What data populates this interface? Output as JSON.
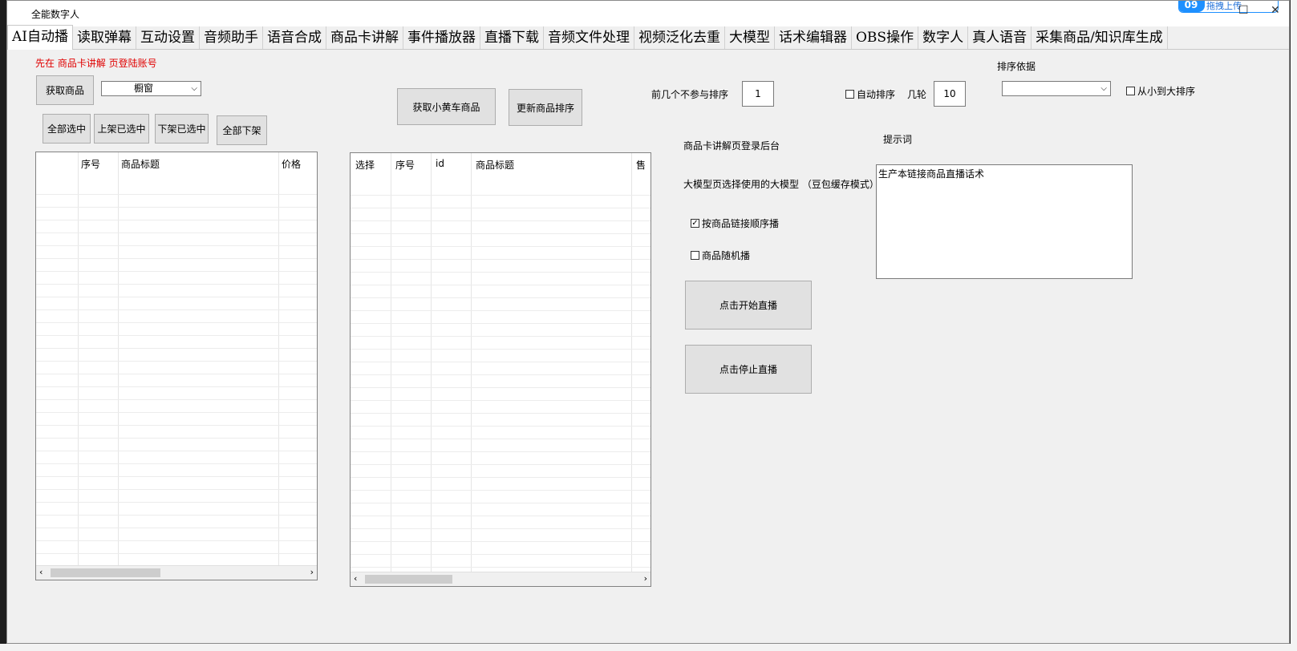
{
  "window": {
    "title": "全能数字人",
    "upload_badge": "09",
    "upload_text": "拖拽上传"
  },
  "tabs": [
    {
      "label": "AI自动播",
      "active": true
    },
    {
      "label": "读取弹幕"
    },
    {
      "label": "互动设置"
    },
    {
      "label": "音频助手"
    },
    {
      "label": "语音合成"
    },
    {
      "label": "商品卡讲解"
    },
    {
      "label": "事件播放器"
    },
    {
      "label": "直播下载"
    },
    {
      "label": "音频文件处理"
    },
    {
      "label": "视频泛化去重"
    },
    {
      "label": "大模型"
    },
    {
      "label": "话术编辑器"
    },
    {
      "label": "OBS操作"
    },
    {
      "label": "数字人"
    },
    {
      "label": "真人语音"
    },
    {
      "label": "采集商品/知识库生成"
    }
  ],
  "main": {
    "notice": "先在 商品卡讲解 页登陆账号",
    "get_products": "获取商品",
    "source_select": "橱窗",
    "select_all": "全部选中",
    "list_selected": "上架已选中",
    "unlist_selected": "下架已选中",
    "unlist_all": "全部下架",
    "get_yellow_cart": "获取小黄车商品",
    "update_sort": "更新商品排序",
    "skip_first_label": "前几个不参与排序",
    "skip_first_value": "1",
    "auto_sort_label": "自动排序",
    "rounds_label": "几轮",
    "rounds_value": "10",
    "sort_by_label": "排序依据",
    "sort_by_value": "",
    "asc_label": "从小到大排序",
    "login_hint": "商品卡讲解页登录后台",
    "model_hint": "大模型页选择使用的大模型 （豆包缓存模式）",
    "prompt_label": "提示词",
    "prompt_value": "生产本链接商品直播话术",
    "order_play_label": "按商品链接顺序播",
    "order_play_checked": true,
    "random_play_label": "商品随机播",
    "random_play_checked": false,
    "start_live": "点击开始直播",
    "stop_live": "点击停止直播"
  },
  "left_table": {
    "columns": [
      "",
      "序号",
      "商品标题",
      "价格"
    ]
  },
  "right_table": {
    "columns": [
      "选择",
      "序号",
      "id",
      "商品标题",
      "售"
    ]
  }
}
